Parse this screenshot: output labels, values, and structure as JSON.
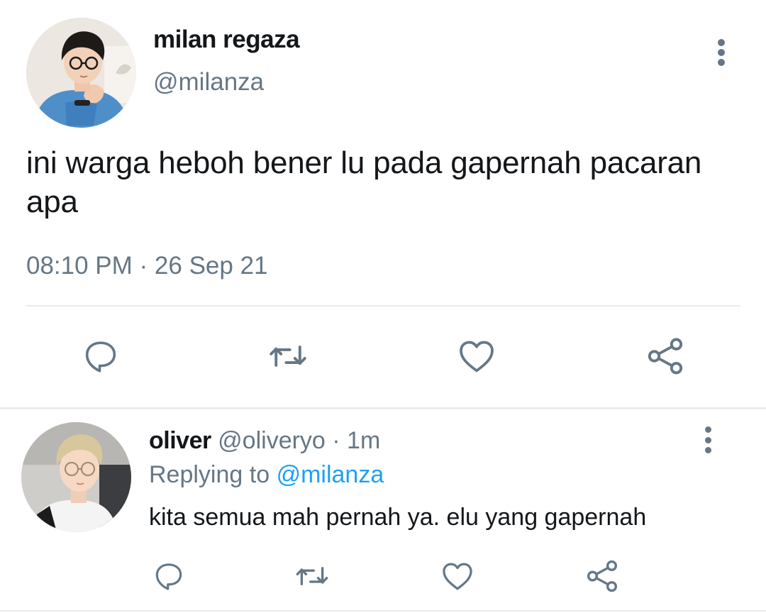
{
  "main_tweet": {
    "author_name": "milan regaza",
    "author_handle": "@milanza",
    "text": "ini warga heboh bener lu pada gapernah pacaran apa",
    "timestamp": "08:10 PM · 26 Sep 21",
    "actions": [
      "comment-icon",
      "retweet-icon",
      "like-icon",
      "share-icon"
    ]
  },
  "reply": {
    "author_name": "oliver",
    "author_meta": "@oliveryo · 1m",
    "replying_prefix": "Replying to",
    "replying_handle": "@milanza",
    "text": "kita semua mah pernah ya. elu yang gapernah",
    "actions": [
      "comment-icon",
      "retweet-icon",
      "like-icon",
      "share-icon"
    ]
  },
  "colors": {
    "text_primary": "#14171a",
    "text_secondary": "#657786",
    "accent": "#1da1f2",
    "divider": "#e6ecf0"
  }
}
